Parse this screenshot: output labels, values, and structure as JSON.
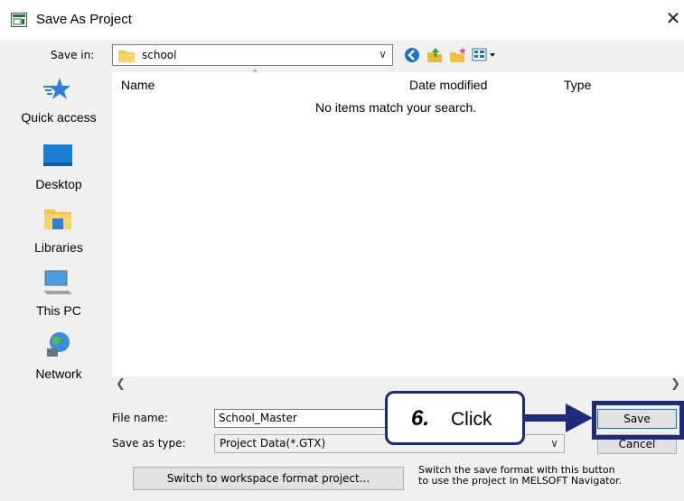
{
  "window": {
    "title": "Save As Project",
    "close_glyph": "✕"
  },
  "save_in": {
    "label": "Save in:",
    "value": "school"
  },
  "places": [
    {
      "label": "Quick access",
      "icon": "star-icon"
    },
    {
      "label": "Desktop",
      "icon": "desktop-icon"
    },
    {
      "label": "Libraries",
      "icon": "libraries-icon"
    },
    {
      "label": "This PC",
      "icon": "computer-icon"
    },
    {
      "label": "Network",
      "icon": "network-icon"
    }
  ],
  "file_list": {
    "columns": [
      "Name",
      "Date modified",
      "Type"
    ],
    "empty_message": "No items match your search."
  },
  "form": {
    "file_name_label": "File name:",
    "file_name_value": "School_Master",
    "save_type_label": "Save as type:",
    "save_type_value": "Project Data(*.GTX)"
  },
  "buttons": {
    "save": "Save",
    "cancel": "Cancel",
    "switch": "Switch to workspace format project..."
  },
  "hint": {
    "line1": "Switch the save format with this button",
    "line2": "to use the project in MELSOFT Navigator."
  },
  "annotation": {
    "step": "6.",
    "text": "Click",
    "color": "#1f2a7a"
  }
}
